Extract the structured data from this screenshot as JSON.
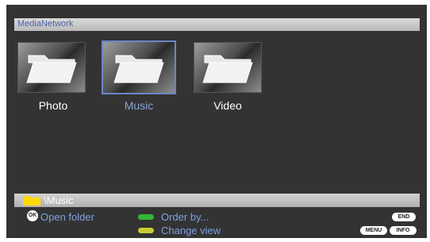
{
  "header": {
    "title": "MediaNetwork"
  },
  "tiles": [
    {
      "label": "Photo",
      "selected": false,
      "icon": "folder-icon"
    },
    {
      "label": "Music",
      "selected": true,
      "icon": "folder-icon"
    },
    {
      "label": "Video",
      "selected": false,
      "icon": "folder-icon"
    }
  ],
  "path_bar": {
    "path": "\\Music"
  },
  "hints": {
    "ok_key": "OK",
    "open_folder": "Open folder",
    "order_by": "Order by...",
    "change_view": "Change view",
    "end_key": "END",
    "menu_key": "MENU",
    "info_key": "INFO"
  },
  "colors": {
    "background": "#333333",
    "highlight": "#6a86c8",
    "green_key": "#33b833",
    "yellow_key": "#c8cc33",
    "folder_yellow": "#ffd800"
  }
}
